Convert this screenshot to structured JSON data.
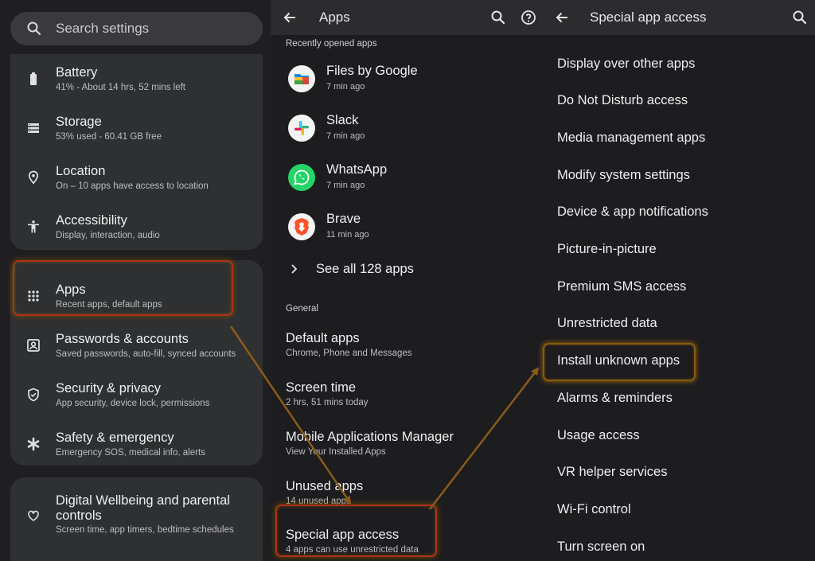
{
  "settings": {
    "search_placeholder": "Search settings",
    "items_group1": [
      {
        "title": "Battery",
        "subtitle": "41% - About 14 hrs, 52 mins left",
        "icon": "battery-icon"
      },
      {
        "title": "Storage",
        "subtitle": "53% used - 60.41 GB free",
        "icon": "storage-icon"
      },
      {
        "title": "Location",
        "subtitle": "On – 10 apps have access to location",
        "icon": "location-icon"
      },
      {
        "title": "Accessibility",
        "subtitle": "Display, interaction, audio",
        "icon": "accessibility-icon"
      }
    ],
    "items_group2": [
      {
        "title": "Apps",
        "subtitle": "Recent apps, default apps",
        "icon": "apps-grid-icon"
      },
      {
        "title": "Passwords & accounts",
        "subtitle": "Saved passwords, auto-fill, synced accounts",
        "icon": "account-box-icon"
      },
      {
        "title": "Security & privacy",
        "subtitle": "App security, device lock, permissions",
        "icon": "shield-icon"
      },
      {
        "title": "Safety & emergency",
        "subtitle": "Emergency SOS, medical info, alerts",
        "icon": "asterisk-icon"
      }
    ],
    "items_group3": [
      {
        "title": "Digital Wellbeing and parental",
        "title2": "controls",
        "subtitle": "Screen time, app timers, bedtime schedules",
        "icon": "wellbeing-icon"
      }
    ]
  },
  "apps": {
    "title": "Apps",
    "recent_label": "Recently opened apps",
    "recent": [
      {
        "name": "Files by Google",
        "time": "7 min ago",
        "icon": "files-by-google-icon"
      },
      {
        "name": "Slack",
        "time": "7 min ago",
        "icon": "slack-icon"
      },
      {
        "name": "WhatsApp",
        "time": "7 min ago",
        "icon": "whatsapp-icon"
      },
      {
        "name": "Brave",
        "time": "11 min ago",
        "icon": "brave-icon"
      }
    ],
    "see_all": "See all 128 apps",
    "general_label": "General",
    "general": [
      {
        "title": "Default apps",
        "subtitle": "Chrome, Phone and Messages"
      },
      {
        "title": "Screen time",
        "subtitle": "2 hrs, 51 mins today"
      },
      {
        "title": "Mobile Applications Manager",
        "subtitle": "View Your Installed Apps"
      },
      {
        "title": "Unused apps",
        "subtitle": "14 unused apps"
      },
      {
        "title": "Special app access",
        "subtitle": "4 apps can use unrestricted data"
      }
    ]
  },
  "special": {
    "title": "Special app access",
    "items": [
      "Display over other apps",
      "Do Not Disturb access",
      "Media management apps",
      "Modify system settings",
      "Device & app notifications",
      "Picture-in-picture",
      "Premium SMS access",
      "Unrestricted data",
      "Install unknown apps",
      "Alarms & reminders",
      "Usage access",
      "VR helper services",
      "Wi-Fi control",
      "Turn screen on"
    ]
  },
  "colors": {
    "highlight_red": "#b0301a",
    "arrow": "#8a5a1a"
  }
}
